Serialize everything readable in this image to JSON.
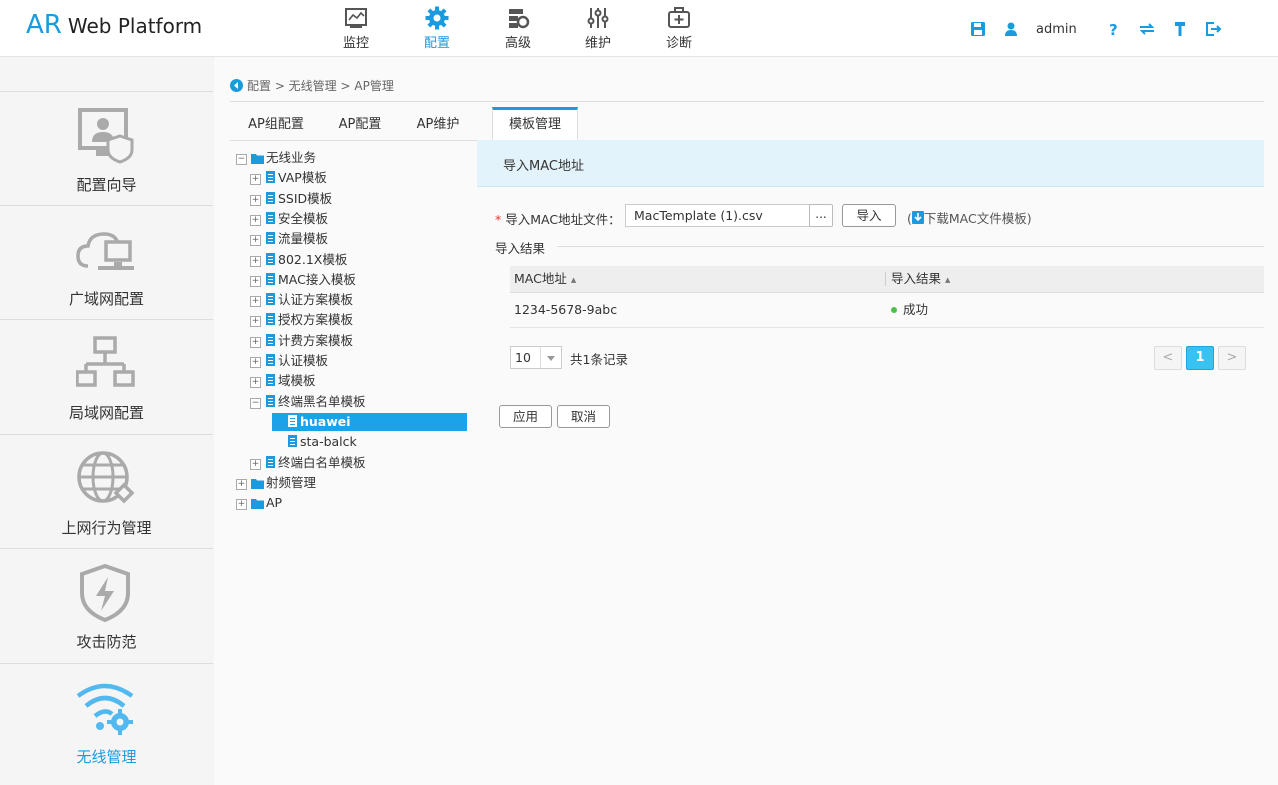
{
  "header": {
    "logo_ar": "AR",
    "logo_text": "Web Platform",
    "nav": [
      {
        "label": "监控",
        "icon": "monitor-icon"
      },
      {
        "label": "配置",
        "icon": "gear-icon"
      },
      {
        "label": "高级",
        "icon": "advanced-icon"
      },
      {
        "label": "维护",
        "icon": "sliders-icon"
      },
      {
        "label": "诊断",
        "icon": "medical-kit-icon"
      }
    ],
    "active_nav": "配置",
    "user": "admin"
  },
  "sidebar": {
    "items": [
      {
        "label": "配置向导",
        "icon": "config-wizard-icon"
      },
      {
        "label": "广域网配置",
        "icon": "wan-cloud-icon"
      },
      {
        "label": "局域网配置",
        "icon": "lan-icon"
      },
      {
        "label": "上网行为管理",
        "icon": "internet-behavior-icon"
      },
      {
        "label": "攻击防范",
        "icon": "shield-icon"
      },
      {
        "label": "无线管理",
        "icon": "wifi-gear-icon"
      }
    ],
    "active": "无线管理"
  },
  "breadcrumb": "配置 > 无线管理 > AP管理",
  "tabs": [
    "AP组配置",
    "AP配置",
    "AP维护",
    "模板管理"
  ],
  "active_tab": "模板管理",
  "tree": {
    "root": "无线业务",
    "children": [
      "VAP模板",
      "SSID模板",
      "安全模板",
      "流量模板",
      "802.1X模板",
      "MAC接入模板",
      "认证方案模板",
      "授权方案模板",
      "计费方案模板",
      "认证模板",
      "域模板",
      "终端黑名单模板"
    ],
    "blacklist_children": [
      "huawei",
      "sta-balck"
    ],
    "after": "终端白名单模板",
    "others": [
      "射频管理",
      "AP"
    ],
    "selected": "huawei"
  },
  "panel": {
    "title": "导入MAC地址",
    "import_label": "导入MAC地址文件：",
    "file_value": "MacTemplate (1).csv",
    "browse": "...",
    "import_btn": "导入",
    "download_open": "(",
    "download_link": "下载MAC文件模板)",
    "result_label": "导入结果",
    "columns": [
      "MAC地址",
      "导入结果"
    ],
    "rows": [
      {
        "mac": "1234-5678-9abc",
        "result": "成功"
      }
    ],
    "page_size": "10",
    "total": "共1条记录",
    "page": "1",
    "prev": "<",
    "next": ">",
    "apply": "应用",
    "cancel": "取消"
  },
  "colors": {
    "accent": "#1a9be0",
    "success": "#4cc24c",
    "selection": "#1aa3e8"
  }
}
